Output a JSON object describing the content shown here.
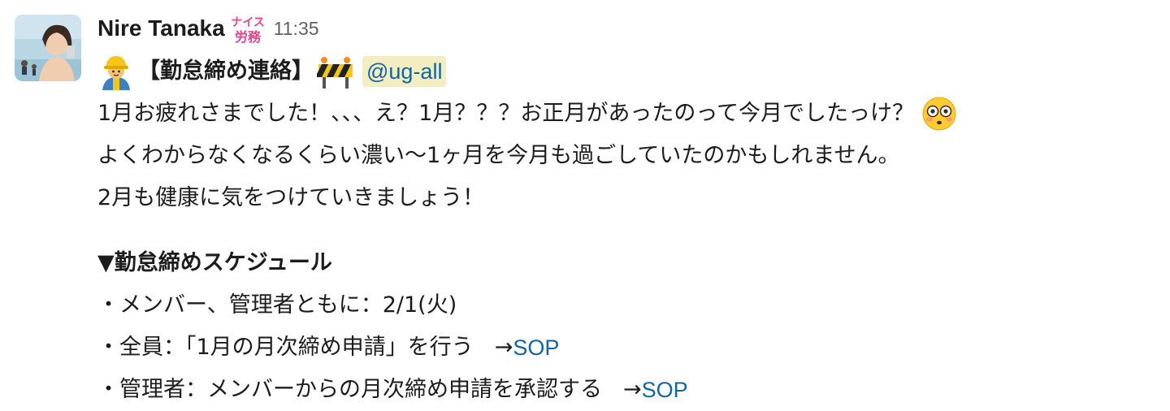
{
  "message": {
    "sender_name": "Nire Tanaka",
    "status_badge_icon": "nice-labor-badge-icon",
    "status_badge_text_top": "ナイス",
    "status_badge_text_bottom": "労務",
    "timestamp": "11:35",
    "title": {
      "prefix_emoji": "construction-worker-icon",
      "text": "【勤怠締め連絡】",
      "suffix_emoji": "construction-barrier-icon",
      "mention": "@ug-all"
    },
    "body_lines": [
      "1月お疲れさまでした！、、、え？1月？？？お正月があったのって今月でしたっけ？",
      "よくわからなくなるくらい濃い〜1ヶ月を今月も過ごしていたのかもしれません。",
      "2月も健康に気をつけていきましょう！"
    ],
    "body_line1_emoji": "flushed-face-icon",
    "schedule": {
      "heading": "▼勤怠締めスケジュール",
      "items": [
        {
          "text": "・メンバー、管理者ともに：2/1(火)"
        },
        {
          "text": "・全員：「1月の月次締め申請」を行う",
          "arrow": "→",
          "link": "SOP"
        },
        {
          "text": "・管理者：メンバーからの月次締め申請を承認する",
          "arrow": "→",
          "link": "SOP"
        }
      ]
    }
  },
  "colors": {
    "link": "#1264a3",
    "mention_bg": "#f2eec1",
    "badge": "#e8428c",
    "timestamp": "#616061"
  }
}
